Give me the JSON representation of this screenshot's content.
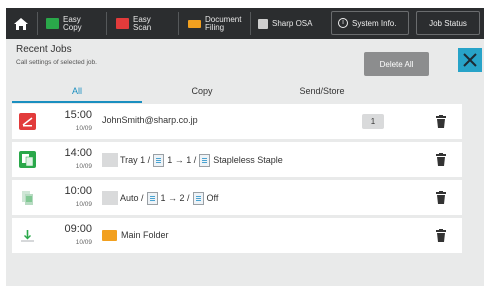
{
  "topbar": {
    "items": [
      {
        "label": "Easy\nCopy",
        "icon": "easy-copy-icon",
        "color": "#2aa84a"
      },
      {
        "label": "Easy\nScan",
        "icon": "easy-scan-icon",
        "color": "#e23b3b"
      },
      {
        "label": "Document\nFiling",
        "icon": "document-filing-icon",
        "color": "#f2a01f"
      },
      {
        "label": "Sharp OSA",
        "icon": "sharp-osa-icon",
        "color": "#cfcfcf"
      }
    ],
    "system_info": "System Info.",
    "job_status": "Job Status"
  },
  "header": {
    "title": "Recent Jobs",
    "subtitle": "Call settings of selected job.",
    "delete_all": "Delete All"
  },
  "tabs": [
    {
      "label": "All",
      "active": true
    },
    {
      "label": "Copy",
      "active": false
    },
    {
      "label": "Send/Store",
      "active": false
    }
  ],
  "jobs": [
    {
      "type": "scan",
      "time": "15:00",
      "date": "10/09",
      "text": "JohnSmith@sharp.co.jp",
      "count": "1"
    },
    {
      "type": "copy",
      "time": "14:00",
      "date": "10/09",
      "tray": "Tray 1 /",
      "sides": "1 → 1 /",
      "finish": "Stapleless Staple"
    },
    {
      "type": "copy-light",
      "time": "10:00",
      "date": "10/09",
      "tray": "Auto /",
      "sides": "1 → 2 /",
      "finish": "Off"
    },
    {
      "type": "filing",
      "time": "09:00",
      "date": "10/09",
      "text": "Main Folder"
    }
  ],
  "colors": {
    "accent": "#1a8fc0",
    "close": "#27a3c8",
    "topbar": "#2b2d2f"
  }
}
